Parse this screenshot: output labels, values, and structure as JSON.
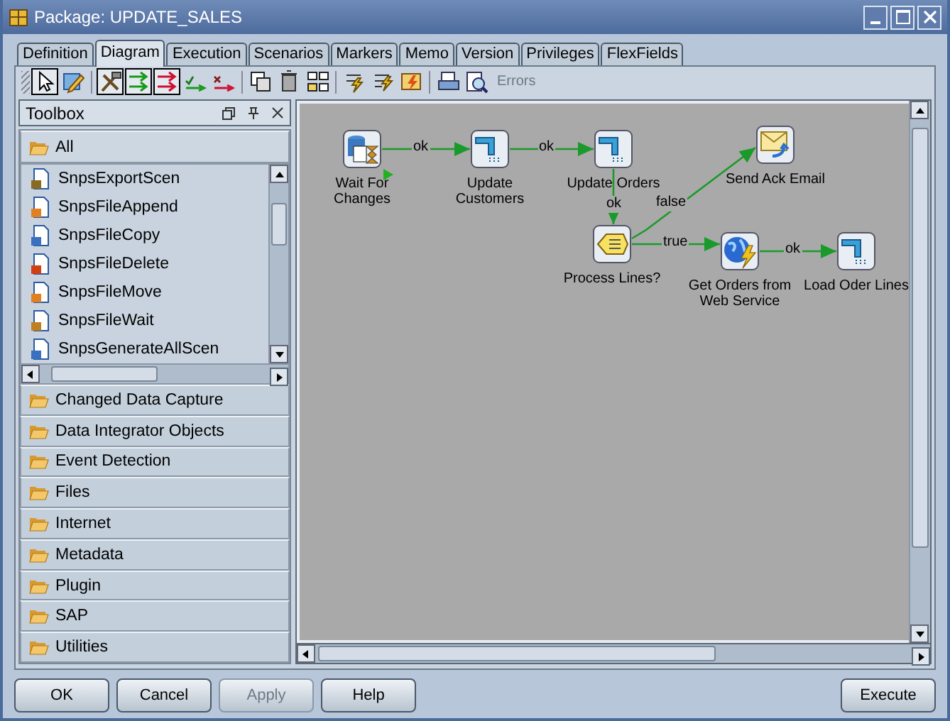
{
  "window": {
    "title": "Package: UPDATE_SALES"
  },
  "tabs": [
    {
      "label": "Definition",
      "selected": false
    },
    {
      "label": "Diagram",
      "selected": true
    },
    {
      "label": "Execution",
      "selected": false
    },
    {
      "label": "Scenarios",
      "selected": false
    },
    {
      "label": "Markers",
      "selected": false
    },
    {
      "label": "Memo",
      "selected": false
    },
    {
      "label": "Version",
      "selected": false
    },
    {
      "label": "Privileges",
      "selected": false
    },
    {
      "label": "FlexFields",
      "selected": false
    }
  ],
  "toolbar": {
    "tools": [
      {
        "kind": "pointer",
        "selected": true
      },
      {
        "kind": "edit",
        "selected": false
      },
      {
        "kind": "tools",
        "selected": true
      },
      {
        "kind": "steps-ok",
        "selected": true
      },
      {
        "kind": "steps-ko",
        "selected": true
      },
      {
        "kind": "link-ok",
        "selected": false
      },
      {
        "kind": "link-ko",
        "selected": false
      },
      {
        "kind": "copy",
        "selected": false
      },
      {
        "kind": "delete",
        "selected": false
      },
      {
        "kind": "arrange",
        "selected": false
      },
      {
        "kind": "validate",
        "selected": false
      },
      {
        "kind": "validate-all",
        "selected": false
      },
      {
        "kind": "execute",
        "selected": false
      },
      {
        "kind": "print",
        "selected": false
      },
      {
        "kind": "preview",
        "selected": false
      }
    ],
    "errors": {
      "label": "Errors",
      "disabled": true
    }
  },
  "toolbox": {
    "title": "Toolbox",
    "open_folder": "All",
    "items": [
      {
        "label": "SnpsExportScen",
        "kind": "export"
      },
      {
        "label": "SnpsFileAppend",
        "kind": "append"
      },
      {
        "label": "SnpsFileCopy",
        "kind": "copy"
      },
      {
        "label": "SnpsFileDelete",
        "kind": "delete"
      },
      {
        "label": "SnpsFileMove",
        "kind": "move"
      },
      {
        "label": "SnpsFileWait",
        "kind": "wait"
      },
      {
        "label": "SnpsGenerateAllScen",
        "kind": "generate"
      }
    ],
    "folders": [
      "Changed Data Capture",
      "Data Integrator Objects",
      "Event Detection",
      "Files",
      "Internet",
      "Metadata",
      "Plugin",
      "SAP",
      "Utilities"
    ]
  },
  "diagram": {
    "nodes": [
      {
        "label": "Wait For Changes",
        "kind": "wait",
        "first_step": true
      },
      {
        "label": "Update Customers",
        "kind": "interface",
        "first_step": false
      },
      {
        "label": "Update Orders",
        "kind": "interface",
        "first_step": false
      },
      {
        "label": "Send Ack Email",
        "kind": "email",
        "first_step": false
      },
      {
        "label": "Process Lines?",
        "kind": "condition",
        "first_step": false
      },
      {
        "label": "Get Orders from Web Service",
        "kind": "webservice",
        "first_step": false
      },
      {
        "label": "Load Oder Lines",
        "kind": "interface",
        "first_step": false
      }
    ],
    "links": [
      {
        "label": "ok"
      },
      {
        "label": "ok"
      },
      {
        "label": "ok"
      },
      {
        "label": "false"
      },
      {
        "label": "true"
      },
      {
        "label": "ok"
      }
    ]
  },
  "buttons": [
    {
      "label": "OK",
      "disabled": false
    },
    {
      "label": "Cancel",
      "disabled": false
    },
    {
      "label": "Apply",
      "disabled": true
    },
    {
      "label": "Help",
      "disabled": false
    },
    {
      "label": "Execute",
      "disabled": false
    }
  ]
}
